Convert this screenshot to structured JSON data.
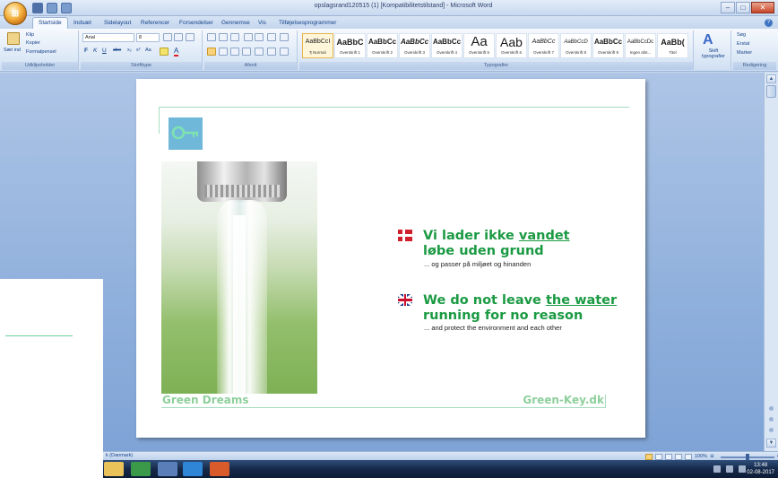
{
  "window": {
    "title": "opslagsrand120515 (1) [Kompatibilitetstilstand] - Microsoft Word",
    "qat_icons": [
      "save-icon",
      "undo-icon",
      "redo-icon"
    ]
  },
  "tabs": [
    "Startside",
    "Indsæt",
    "Sidelayout",
    "Referencer",
    "Forsendelser",
    "Gennemse",
    "Vis",
    "Tilføjelsesprogrammer"
  ],
  "ribbon": {
    "clipboard": {
      "paste": "Sæt ind",
      "cut": "Klip",
      "copy": "Kopier",
      "format_painter": "Formatpensel",
      "label": "Udklipsholder"
    },
    "font": {
      "name": "Arial",
      "size": "8",
      "label": "Skrifttype"
    },
    "paragraph": {
      "label": "Afsnit"
    },
    "styles": {
      "label": "Typografier",
      "items": [
        {
          "sample": "AaBbCcI",
          "name": "¶ Normal"
        },
        {
          "sample": "AaBbC",
          "name": "Overskrift 1"
        },
        {
          "sample": "AaBbCc",
          "name": "Overskrift 2"
        },
        {
          "sample": "AaBbCc",
          "name": "Overskrift 3"
        },
        {
          "sample": "AaBbCc",
          "name": "Overskrift 4"
        },
        {
          "sample": "Aa",
          "name": "Overskrift 5"
        },
        {
          "sample": "Aab",
          "name": "Overskrift 6"
        },
        {
          "sample": "AaBbCc",
          "name": "Overskrift 7"
        },
        {
          "sample": "AaBbCcD",
          "name": "Overskrift 8"
        },
        {
          "sample": "AaBbCc",
          "name": "Overskrift 9"
        },
        {
          "sample": "AaBbCcDc",
          "name": "Ingen afst..."
        },
        {
          "sample": "AaBb(",
          "name": "Titel"
        }
      ],
      "change_styles": "Skift typografier"
    },
    "editing": {
      "find": "Søg",
      "replace": "Erstat",
      "select": "Marker",
      "label": "Redigering"
    }
  },
  "document": {
    "danish": {
      "line1_pre": "Vi lader ikke ",
      "line1_underlined": "vandet",
      "line2": "løbe uden grund",
      "sub": "... og passer på miljøet og hinanden"
    },
    "english": {
      "line1_pre": "We do not leave ",
      "line1_underlined": "the water",
      "line2": "running for no reason",
      "sub": "... and protect the environment and each other"
    },
    "footer_left": "Green Dreams",
    "footer_right": "Green-Key.dk"
  },
  "status": {
    "language": "k (Danmark)",
    "zoom": "100%"
  },
  "taskbar": {
    "time": "13:48",
    "date": "02-08-2017"
  },
  "colors": {
    "headline_green": "#1b9a43",
    "footer_green": "#8fcf9c",
    "ribbon_text": "#15428b"
  }
}
